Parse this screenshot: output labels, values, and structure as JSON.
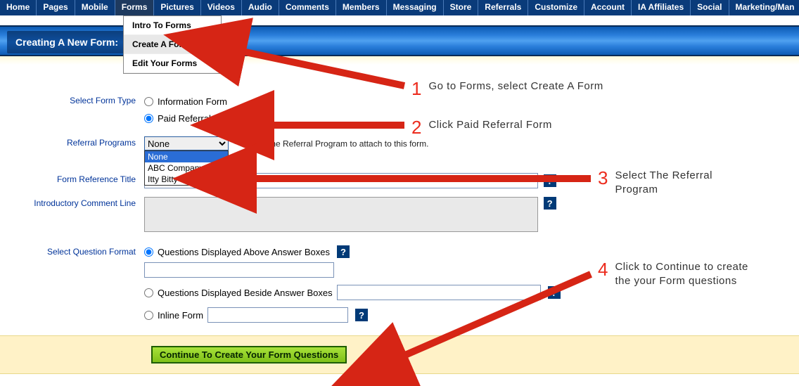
{
  "nav": {
    "items": [
      "Home",
      "Pages",
      "Mobile",
      "Forms",
      "Pictures",
      "Videos",
      "Audio",
      "Comments",
      "Members",
      "Messaging",
      "Store",
      "Referrals",
      "Customize",
      "Account",
      "IA Affiliates",
      "Social",
      "Marketing/Man"
    ]
  },
  "dropdown": {
    "items": [
      "Intro To Forms",
      "Create A Form",
      "Edit Your Forms"
    ]
  },
  "titlebar": {
    "title": "Creating A New Form:"
  },
  "labels": {
    "select_form_type": "Select Form Type",
    "referral_programs": "Referral Programs",
    "form_ref_title": "Form Reference Title",
    "intro_comment": "Introductory Comment Line",
    "select_q_format": "Select Question Format"
  },
  "form_type": {
    "opt1": "Information Form",
    "opt2": "Paid Referral Form"
  },
  "referral": {
    "selected": "None",
    "options": [
      "None",
      "ABC Company",
      "Itty Bitty"
    ],
    "star": "*",
    "hint": "Select the Referral Program to attach to this form."
  },
  "qformat": {
    "opt1": "Questions Displayed Above Answer Boxes",
    "opt2": "Questions Displayed Beside Answer Boxes",
    "opt3": "Inline Form"
  },
  "help_glyph": "?",
  "continue": {
    "label": "Continue To Create Your Form Questions"
  },
  "anno": {
    "a1": {
      "num": "1",
      "text": "Go to Forms, select Create A Form"
    },
    "a2": {
      "num": "2",
      "text": "Click Paid Referral Form"
    },
    "a3": {
      "num": "3",
      "text": "Select The Referral Program"
    },
    "a4": {
      "num": "4",
      "text": "Click to Continue to create the your Form questions"
    }
  }
}
